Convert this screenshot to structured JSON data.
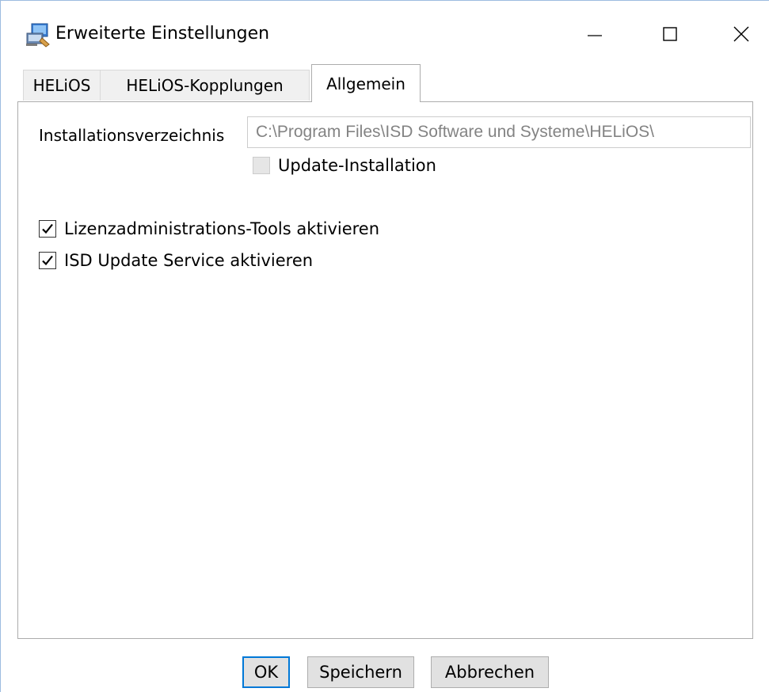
{
  "window": {
    "title": "Erweiterte Einstellungen",
    "icon": "installer-icon",
    "accent_color": "#0078d7"
  },
  "tabs": [
    {
      "label": "HELiOS",
      "selected": false
    },
    {
      "label": "HELiOS-Kopplungen",
      "selected": false
    },
    {
      "label": "Allgemein",
      "selected": true
    }
  ],
  "general": {
    "install_dir_label": "Installationsverzeichnis",
    "install_dir_value": "C:\\Program Files\\ISD Software und Systeme\\HELiOS\\",
    "update_installation": {
      "label": "Update-Installation",
      "checked": false,
      "enabled": false
    },
    "license_tools": {
      "label": "Lizenzadministrations-Tools aktivieren",
      "checked": true
    },
    "isd_update_service": {
      "label": "ISD Update Service aktivieren",
      "checked": true
    }
  },
  "buttons": {
    "ok": "OK",
    "save": "Speichern",
    "cancel": "Abbrechen"
  }
}
